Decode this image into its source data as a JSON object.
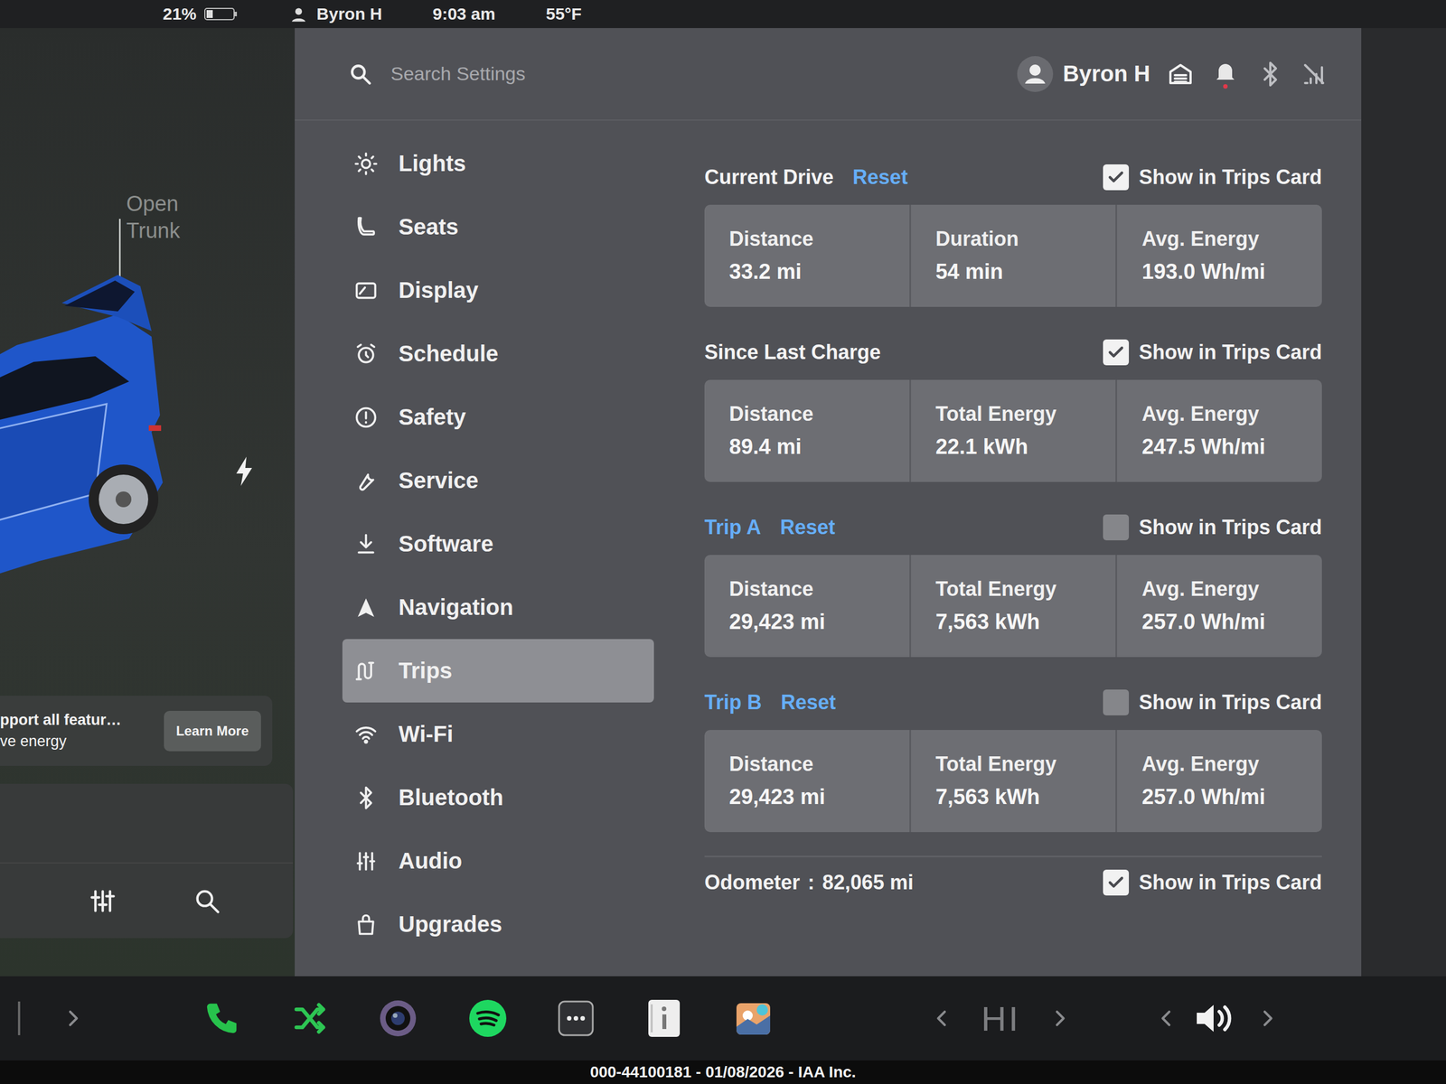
{
  "status_bar": {
    "battery": "21%",
    "user": "Byron H",
    "time": "9:03 am",
    "temperature": "55°F"
  },
  "car": {
    "trunk_label": [
      "Open",
      "Trunk"
    ]
  },
  "notice": {
    "lines": [
      "pport all featur…",
      "ve energy"
    ],
    "button": "Learn More"
  },
  "settings": {
    "search": {
      "placeholder": "Search Settings"
    },
    "user": "Byron H"
  },
  "sidebar": {
    "items": [
      {
        "label": "Lights",
        "selected": false
      },
      {
        "label": "Seats",
        "selected": false
      },
      {
        "label": "Display",
        "selected": false
      },
      {
        "label": "Schedule",
        "selected": false
      },
      {
        "label": "Safety",
        "selected": false
      },
      {
        "label": "Service",
        "selected": false
      },
      {
        "label": "Software",
        "selected": false
      },
      {
        "label": "Navigation",
        "selected": false
      },
      {
        "label": "Trips",
        "selected": true
      },
      {
        "label": "Wi-Fi",
        "selected": false
      },
      {
        "label": "Bluetooth",
        "selected": false
      },
      {
        "label": "Audio",
        "selected": false
      },
      {
        "label": "Upgrades",
        "selected": false
      }
    ]
  },
  "trips": [
    {
      "title": "Current Drive",
      "kind": "drive",
      "reset": "Reset",
      "show_label": "Show in Trips Card",
      "checked": true,
      "stats": [
        {
          "label": "Distance",
          "value": "33.2 mi"
        },
        {
          "label": "Duration",
          "value": "54 min"
        },
        {
          "label": "Avg. Energy",
          "value": "193.0 Wh/mi"
        }
      ]
    },
    {
      "title": "Since Last Charge",
      "kind": "drive",
      "reset": "",
      "show_label": "Show in Trips Card",
      "checked": true,
      "stats": [
        {
          "label": "Distance",
          "value": "89.4 mi"
        },
        {
          "label": "Total Energy",
          "value": "22.1 kWh"
        },
        {
          "label": "Avg. Energy",
          "value": "247.5 Wh/mi"
        }
      ]
    },
    {
      "title": "Trip A",
      "kind": "trip",
      "reset": "Reset",
      "show_label": "Show in Trips Card",
      "checked": false,
      "stats": [
        {
          "label": "Distance",
          "value": "29,423 mi"
        },
        {
          "label": "Total Energy",
          "value": "7,563 kWh"
        },
        {
          "label": "Avg. Energy",
          "value": "257.0 Wh/mi"
        }
      ]
    },
    {
      "title": "Trip B",
      "kind": "trip",
      "reset": "Reset",
      "show_label": "Show in Trips Card",
      "checked": false,
      "stats": [
        {
          "label": "Distance",
          "value": "29,423 mi"
        },
        {
          "label": "Total Energy",
          "value": "7,563 kWh"
        },
        {
          "label": "Avg. Energy",
          "value": "257.0 Wh/mi"
        }
      ]
    }
  ],
  "odometer": {
    "label": "Odometer",
    "separator": ":",
    "value": "82,065 mi",
    "show_label": "Show in Trips Card",
    "checked": true
  },
  "taskbar": {
    "climate": "HI"
  },
  "watermark": "000-44100181 - 01/08/2026 - IAA Inc."
}
